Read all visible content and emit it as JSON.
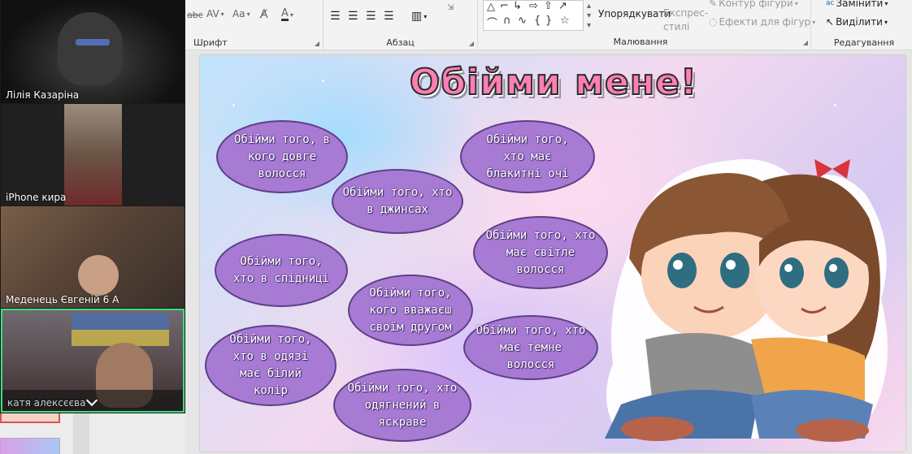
{
  "ribbon": {
    "groups": {
      "font": "Шрифт",
      "paragraph": "Абзац",
      "drawing": "Малювання",
      "editing": "Редагування"
    },
    "font_tools": [
      "abc",
      "AV",
      "Aa",
      "A"
    ],
    "arrange_label": "Упорядкувати",
    "quick_styles_label": "Експрес-стилі",
    "shape_outline_label": "Контур фігури",
    "shape_effects_label": "Ефекти для фігур",
    "replace_label": "Замінити",
    "select_label": "Виділити"
  },
  "participants": [
    {
      "name": "Лілія Казаріна"
    },
    {
      "name": "iPhone кира"
    },
    {
      "name": "Меденець Євгеній 6 А"
    },
    {
      "name": "катя алексєєва"
    }
  ],
  "slide": {
    "title": "Обійми мене!",
    "clouds": [
      "Обійми того, в кого довге волосся",
      "Обійми того, хто в джинсах",
      "Обійми того, хто в спідниці",
      "Обійми того, кого вважаєш своїм другом",
      "Обійми того, хто в одязі має білий колір",
      "Обійми того, хто одягнений в яскраве",
      "Обійми того, хто має блакитні очі",
      "Обійми того, хто має світле волосся",
      "Обійми того, хто має темне волосся"
    ]
  },
  "colors": {
    "cloud_fill": "#a77ad4",
    "cloud_border": "#5e3f86",
    "active_speaker_border": "#3ddc84"
  }
}
